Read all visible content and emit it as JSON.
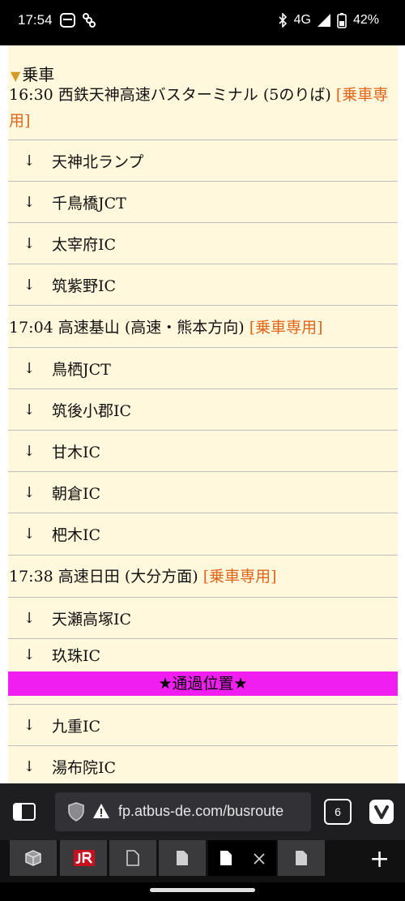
{
  "status": {
    "time": "17:54",
    "network": "4G",
    "battery": "42%"
  },
  "section": {
    "title": "乗車"
  },
  "stops": [
    {
      "time_name": "16:30 西鉄天神高速バスターミナル (5のりば)",
      "tag": "[乗車専用]"
    },
    {
      "time_name": "17:04 高速基山 (高速・熊本方向)",
      "tag": "[乗車専用]"
    },
    {
      "time_name": "17:38 高速日田 (大分方面)",
      "tag": "[乗車専用]"
    }
  ],
  "arrow": "↓",
  "segments": {
    "a": [
      "天神北ランプ",
      "千鳥橋JCT",
      "太宰府IC",
      "筑紫野IC"
    ],
    "b": [
      "鳥栖JCT",
      "筑後小郡IC",
      "甘木IC",
      "朝倉IC",
      "杷木IC"
    ],
    "c": [
      "天瀬高塚IC",
      "玖珠IC"
    ],
    "d": [
      "九重IC",
      "湯布院IC"
    ]
  },
  "pass_banner": "★通過位置★",
  "browser": {
    "url": "fp.atbus-de.com/busroute",
    "tab_count": "6"
  },
  "icons": {
    "panel": "sidebar-panel-icon",
    "security": "shield-icon",
    "warning": "warning-icon",
    "vivaldi": "vivaldi-icon",
    "add_tab": "plus-icon"
  }
}
